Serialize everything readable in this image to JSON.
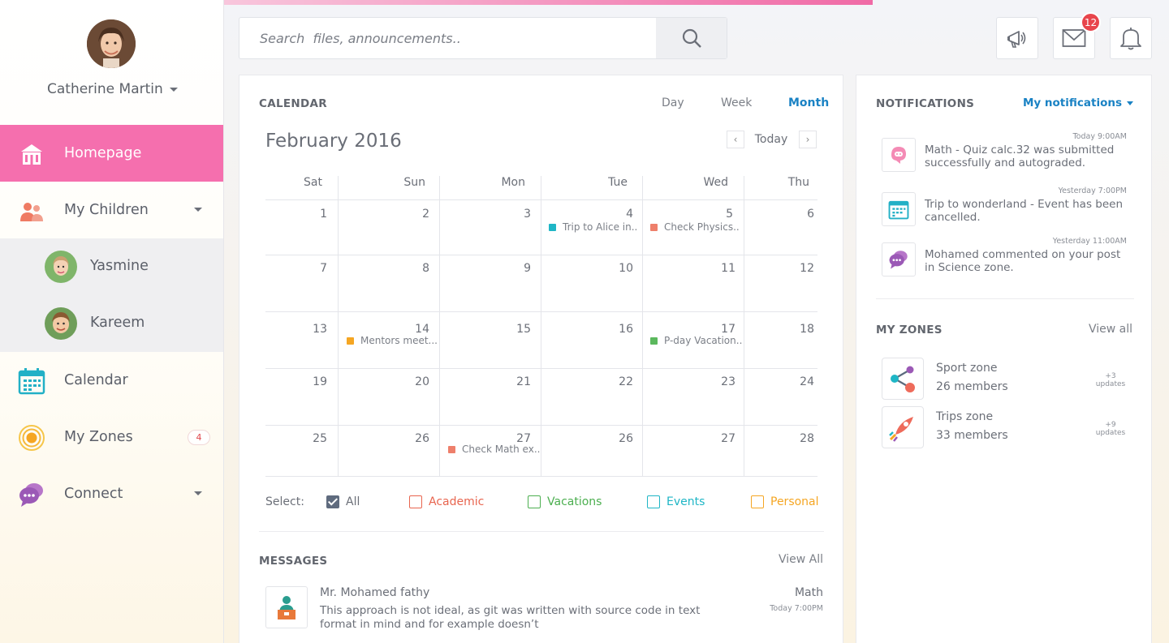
{
  "user": {
    "name": "Catherine Martin"
  },
  "sidebar": {
    "items": [
      {
        "label": "Homepage",
        "icon": "school-icon"
      },
      {
        "label": "My Children",
        "icon": "children-icon"
      },
      {
        "label": "Calendar",
        "icon": "calendar-icon"
      },
      {
        "label": "My Zones",
        "icon": "zones-icon",
        "badge": "4"
      },
      {
        "label": "Connect",
        "icon": "chat-icon"
      }
    ],
    "children": [
      {
        "name": "Yasmine"
      },
      {
        "name": "Kareem"
      }
    ]
  },
  "search": {
    "placeholder": "Search  files, announcements.."
  },
  "topbar": {
    "mail_count": "12"
  },
  "calendar": {
    "title": "CALENDAR",
    "views": [
      "Day",
      "Week",
      "Month"
    ],
    "active_view": "Month",
    "month": "February 2016",
    "today_label": "Today",
    "days_of_week": [
      "Sat",
      "Sun",
      "Mon",
      "Tue",
      "Wed",
      "Thu"
    ],
    "weeks": [
      [
        "1",
        "2",
        "3",
        "4",
        "5",
        "6"
      ],
      [
        "7",
        "8",
        "9",
        "10",
        "11",
        "12"
      ],
      [
        "13",
        "14",
        "15",
        "16",
        "17",
        "18"
      ],
      [
        "19",
        "20",
        "21",
        "22",
        "23",
        "24"
      ],
      [
        "25",
        "26",
        "27",
        "26",
        "27",
        "28"
      ]
    ],
    "events": [
      {
        "label": "Trip to Alice in..",
        "color": "#1fb6c6"
      },
      {
        "label": "Check Physics..",
        "color": "#ee7f6b"
      },
      {
        "label": "Mentors meet...",
        "color": "#f5a623"
      },
      {
        "label": "P-day Vacation..",
        "color": "#5bb85d"
      },
      {
        "label": "Check Math ex..",
        "color": "#ee7f6b"
      }
    ],
    "filters": {
      "label": "Select:",
      "items": [
        {
          "label": "All",
          "color": "#5f6b7e",
          "checked": true
        },
        {
          "label": "Academic",
          "color": "#e8654f"
        },
        {
          "label": "Vacations",
          "color": "#4caf50"
        },
        {
          "label": "Events",
          "color": "#1fb6c6"
        },
        {
          "label": "Personal",
          "color": "#f5a623"
        }
      ]
    }
  },
  "messages": {
    "title": "MESSAGES",
    "view_all": "View All",
    "items": [
      {
        "sender": "Mr. Mohamed fathy",
        "body": "This approach is not ideal, as git was written with source code in text format in mind and for example doesn’t",
        "subject": "Math",
        "time": "Today 7:00PM"
      }
    ]
  },
  "notifications": {
    "title": "NOTIFICATIONS",
    "filter": "My notifications",
    "items": [
      {
        "time": "Today 9:00AM",
        "text": "Math - Quiz calc.32 was submitted successfully and autograded.",
        "icon": "quiz-icon"
      },
      {
        "time": "Yesterday 7:00PM",
        "text": "Trip to wonderland - Event has been cancelled.",
        "icon": "calendar-icon"
      },
      {
        "time": "Yesterday 11:00AM",
        "text": "Mohamed commented on your post in Science zone.",
        "icon": "chat-icon"
      }
    ]
  },
  "zones": {
    "title": "MY ZONES",
    "view_all": "View all",
    "items": [
      {
        "name": "Sport zone",
        "members": "26 members",
        "updates_count": "+3",
        "updates_label": "updates",
        "icon": "share-icon"
      },
      {
        "name": "Trips zone",
        "members": "33 members",
        "updates_count": "+9",
        "updates_label": "updates",
        "icon": "rocket-icon"
      }
    ]
  },
  "colors": {
    "accent": "#f56fae",
    "link": "#1a82c4"
  }
}
